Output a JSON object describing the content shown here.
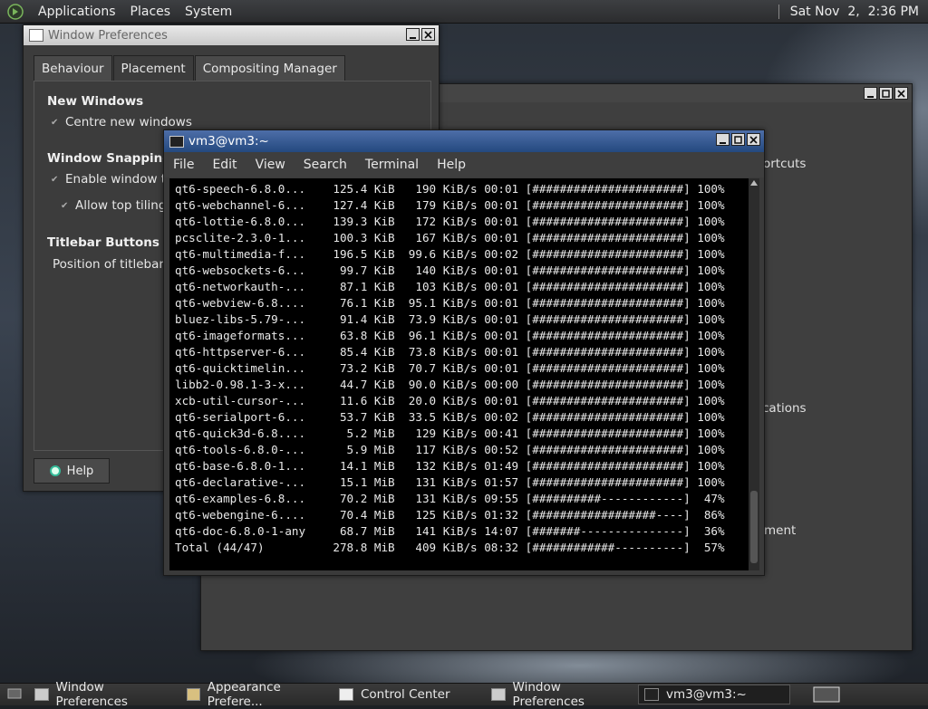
{
  "top_panel": {
    "menus": [
      "Applications",
      "Places",
      "System"
    ],
    "clock": "Sat Nov  2,  2:36 PM"
  },
  "prefs_window": {
    "title": "Window Preferences",
    "tabs": [
      "Behaviour",
      "Placement",
      "Compositing Manager"
    ],
    "active_tab": "Placement",
    "sections": {
      "new_windows": {
        "heading": "New Windows",
        "option": "Centre new windows"
      },
      "snapping": {
        "heading": "Window Snapping",
        "option1": "Enable window tili",
        "option2": "Allow top tiling"
      },
      "titlebar": {
        "heading": "Titlebar Buttons",
        "text": "Position of titlebar b"
      }
    },
    "help_label": "Help"
  },
  "control_center": {
    "visible_fragments": [
      "ortcuts",
      "cations",
      "ment"
    ]
  },
  "terminal": {
    "title": "vm3@vm3:~",
    "menu": [
      "File",
      "Edit",
      "View",
      "Search",
      "Terminal",
      "Help"
    ],
    "lines": [
      "qt6-speech-6.8.0...    125.4 KiB   190 KiB/s 00:01 [######################] 100%",
      "qt6-webchannel-6...    127.4 KiB   179 KiB/s 00:01 [######################] 100%",
      "qt6-lottie-6.8.0...    139.3 KiB   172 KiB/s 00:01 [######################] 100%",
      "pcsclite-2.3.0-1...    100.3 KiB   167 KiB/s 00:01 [######################] 100%",
      "qt6-multimedia-f...    196.5 KiB  99.6 KiB/s 00:02 [######################] 100%",
      "qt6-websockets-6...     99.7 KiB   140 KiB/s 00:01 [######################] 100%",
      "qt6-networkauth-...     87.1 KiB   103 KiB/s 00:01 [######################] 100%",
      "qt6-webview-6.8....     76.1 KiB  95.1 KiB/s 00:01 [######################] 100%",
      "bluez-libs-5.79-...     91.4 KiB  73.9 KiB/s 00:01 [######################] 100%",
      "qt6-imageformats...     63.8 KiB  96.1 KiB/s 00:01 [######################] 100%",
      "qt6-httpserver-6...     85.4 KiB  73.8 KiB/s 00:01 [######################] 100%",
      "qt6-quicktimelin...     73.2 KiB  70.7 KiB/s 00:01 [######################] 100%",
      "libb2-0.98.1-3-x...     44.7 KiB  90.0 KiB/s 00:00 [######################] 100%",
      "xcb-util-cursor-...     11.6 KiB  20.0 KiB/s 00:01 [######################] 100%",
      "qt6-serialport-6...     53.7 KiB  33.5 KiB/s 00:02 [######################] 100%",
      "qt6-quick3d-6.8....      5.2 MiB   129 KiB/s 00:41 [######################] 100%",
      "qt6-tools-6.8.0-...      5.9 MiB   117 KiB/s 00:52 [######################] 100%",
      "qt6-base-6.8.0-1...     14.1 MiB   132 KiB/s 01:49 [######################] 100%",
      "qt6-declarative-...     15.1 MiB   131 KiB/s 01:57 [######################] 100%",
      "qt6-examples-6.8...     70.2 MiB   131 KiB/s 09:55 [##########------------]  47%",
      "qt6-webengine-6....     70.4 MiB   125 KiB/s 01:32 [##################----]  86%",
      "qt6-doc-6.8.0-1-any     68.7 MiB   141 KiB/s 14:07 [#######---------------]  36%",
      "Total (44/47)          278.8 MiB   409 KiB/s 08:32 [############----------]  57%"
    ]
  },
  "taskbar": {
    "items": [
      "Window Preferences",
      "Appearance Prefere...",
      "Control Center",
      "Window Preferences",
      "vm3@vm3:~"
    ],
    "active_index": 4
  }
}
